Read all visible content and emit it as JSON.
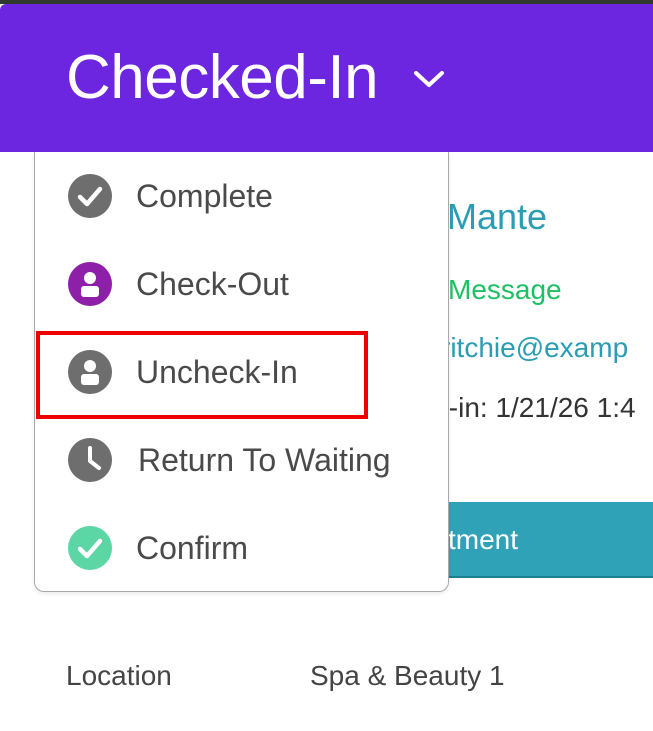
{
  "header": {
    "status_label": "Checked-In"
  },
  "client": {
    "name_partial": "Mante",
    "message_link": "Message",
    "email_partial": "ritchie@examp",
    "checkin_partial": "t-in: 1/21/26 1:4"
  },
  "appointment_button_partial": "tment",
  "details": [
    {
      "label": "Location",
      "value": "Spa & Beauty 1"
    }
  ],
  "menu": {
    "items": [
      {
        "label": "Complete",
        "icon": "check-circle-icon",
        "color": "#6e6e6e"
      },
      {
        "label": "Check-Out",
        "icon": "person-circle-icon",
        "color": "#8e1fa8"
      },
      {
        "label": "Uncheck-In",
        "icon": "person-circle-icon",
        "color": "#6e6e6e",
        "highlighted": true
      },
      {
        "label": "Return To Waiting",
        "icon": "clock-icon",
        "color": "#6e6e6e"
      },
      {
        "label": "Confirm",
        "icon": "check-circle-icon",
        "color": "#5cd6a4"
      }
    ]
  },
  "colors": {
    "header_bg": "#6c26e0",
    "link_teal": "#2a9db4",
    "message_green": "#1fc063",
    "button_teal": "#30a2b8",
    "highlight_red": "#ee0000"
  }
}
